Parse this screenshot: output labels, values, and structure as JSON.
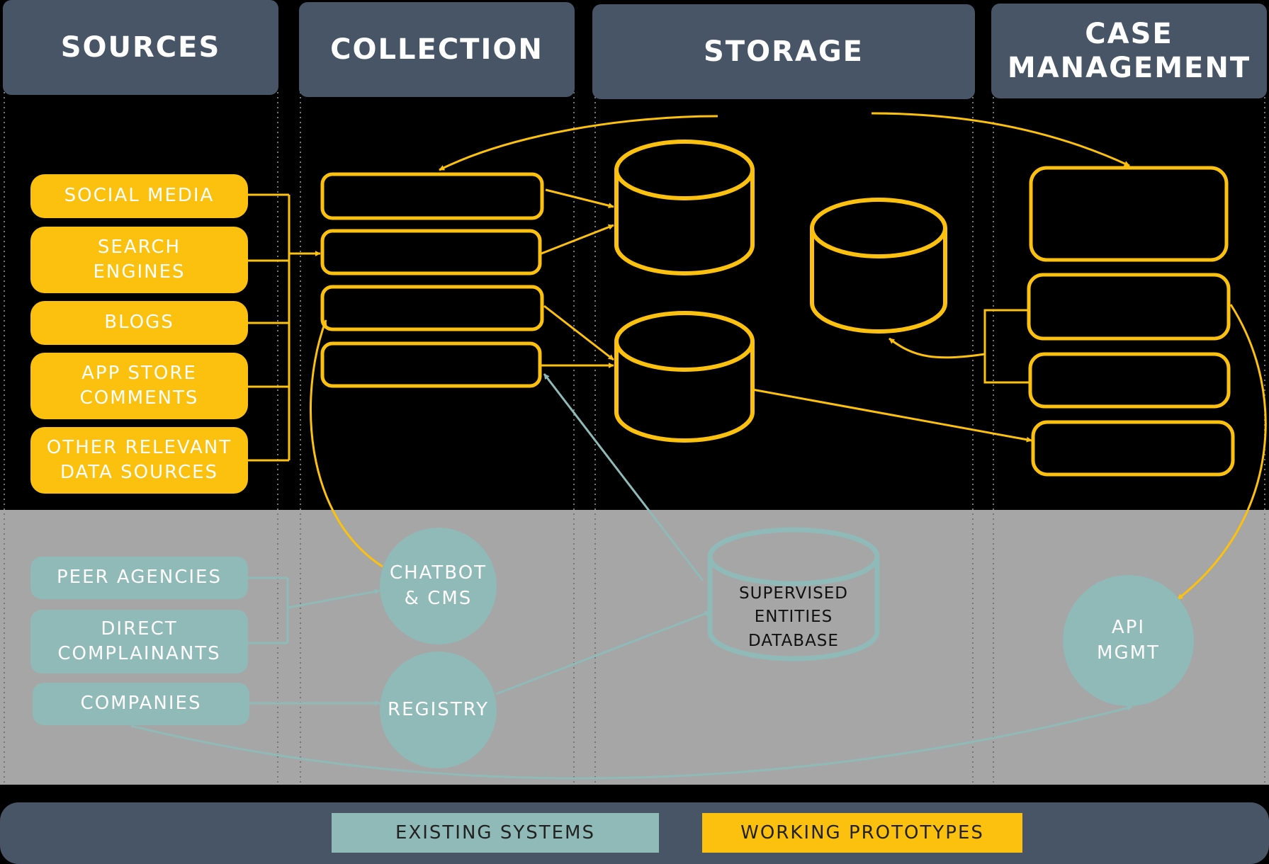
{
  "columns": {
    "sources": "SOURCES",
    "collection": "COLLECTION",
    "storage": "STORAGE",
    "case_management": "CASE\nMANAGEMENT"
  },
  "sources": {
    "social_media": "SOCIAL MEDIA",
    "search_engines": "SEARCH\nENGINES",
    "blogs": "BLOGS",
    "app_store": "APP STORE\nCOMMENTS",
    "other": "OTHER RELEVANT\nDATA SOURCES"
  },
  "existing": {
    "peer_agencies": "PEER AGENCIES",
    "direct_complainants": "DIRECT\nCOMPLAINANTS",
    "companies": "COMPANIES",
    "chatbot": "CHATBOT\n& CMS",
    "registry": "REGISTRY",
    "database": "SUPERVISED\nENTITIES\nDATABASE",
    "api": "API\nMGMT"
  },
  "legend": {
    "existing": "EXISTING SYSTEMS",
    "prototypes": "WORKING PROTOTYPES"
  },
  "colors": {
    "prototype": "#fcc10f",
    "existing": "#8fbab7",
    "header": "#485567",
    "grey_band": "#a6a6a6"
  }
}
